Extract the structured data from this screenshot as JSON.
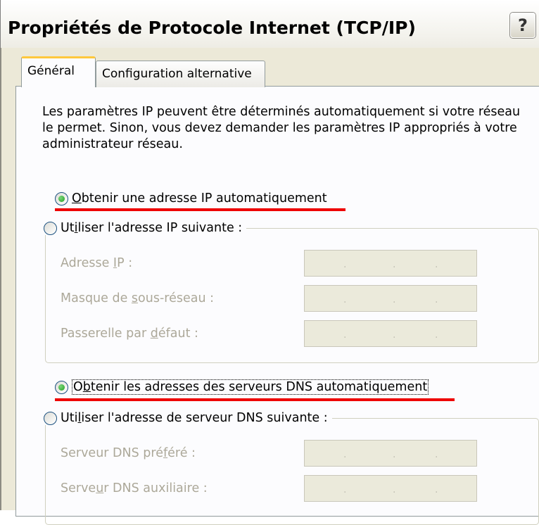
{
  "window": {
    "title": "Propriétés de Protocole Internet (TCP/IP)",
    "help_button": "?"
  },
  "tabs": [
    {
      "label": "Général",
      "active": true
    },
    {
      "label": "Configuration alternative",
      "active": false
    }
  ],
  "description": "Les paramètres IP peuvent être déterminés automatiquement si votre réseau le permet. Sinon, vous devez demander les paramètres IP appropriés à votre administrateur réseau.",
  "ip_section": {
    "auto_option": {
      "label_first": "O",
      "label_rest": "btenir une adresse IP automatiquement",
      "checked": true
    },
    "manual_option": {
      "label_first": "Ut",
      "label_mn": "i",
      "label_rest": "liser l'adresse IP suivante :",
      "checked": false
    },
    "fields": [
      {
        "label_pre": "Adresse ",
        "label_mn": "I",
        "label_post": "P :",
        "value": ". . ."
      },
      {
        "label_pre": "Masque de ",
        "label_mn": "s",
        "label_post": "ous-réseau :",
        "value": ". . ."
      },
      {
        "label_pre": "Passerelle par ",
        "label_mn": "d",
        "label_post": "éfaut :",
        "value": ". . ."
      }
    ]
  },
  "dns_section": {
    "auto_option": {
      "label_first": "O",
      "label_mn": "b",
      "label_rest": "tenir les adresses des serveurs DNS automatiquement",
      "checked": true
    },
    "manual_option": {
      "label_first": "Uti",
      "label_mn": "l",
      "label_rest": "iser l'adresse de serveur DNS suivante :",
      "checked": false
    },
    "fields": [
      {
        "label_pre": "Serveur DNS pré",
        "label_mn": "f",
        "label_post": "éré :",
        "value": ". . ."
      },
      {
        "label_pre": "Serve",
        "label_mn": "u",
        "label_post": "r DNS auxiliaire :",
        "value": ". . ."
      }
    ]
  },
  "colors": {
    "dialog_bg": "#ece9d8",
    "panel_bg": "#fcfcfe",
    "highlight_underline": "#ee0000",
    "active_tab_accent": "#ffc83c",
    "radio_check": "#21a121"
  }
}
